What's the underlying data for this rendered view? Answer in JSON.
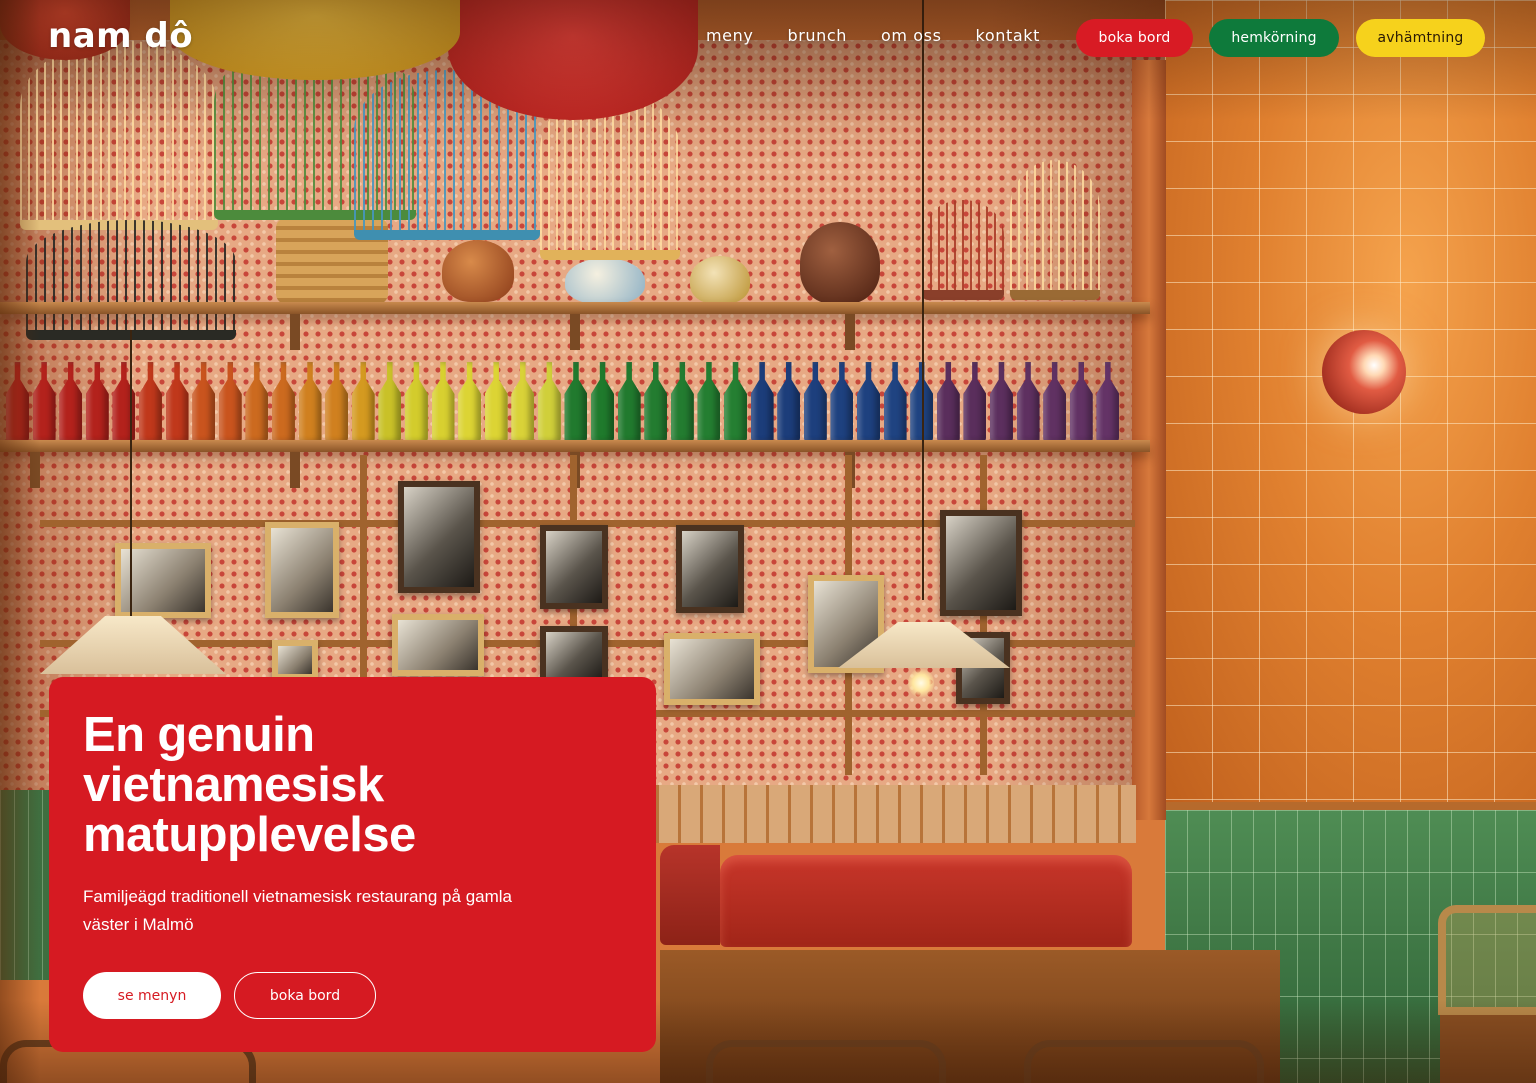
{
  "brand": {
    "logo_text": "nam dô"
  },
  "nav": {
    "items": [
      {
        "label": "meny"
      },
      {
        "label": "brunch"
      },
      {
        "label": "om oss"
      },
      {
        "label": "kontakt"
      }
    ]
  },
  "header_actions": {
    "book": "boka bord",
    "delivery": "hemkörning",
    "pickup": "avhämtning"
  },
  "hero": {
    "heading": "En genuin vietnamesisk matupplevelse",
    "description": "Familjeägd traditionell vietnamesisk restaurang på gamla väster i Malmö",
    "primary_button": "se menyn",
    "secondary_button": "boka bord"
  },
  "colors": {
    "brand_red": "#d61a22",
    "delivery_green": "#0e7a3b",
    "pickup_yellow": "#f6d21c"
  }
}
